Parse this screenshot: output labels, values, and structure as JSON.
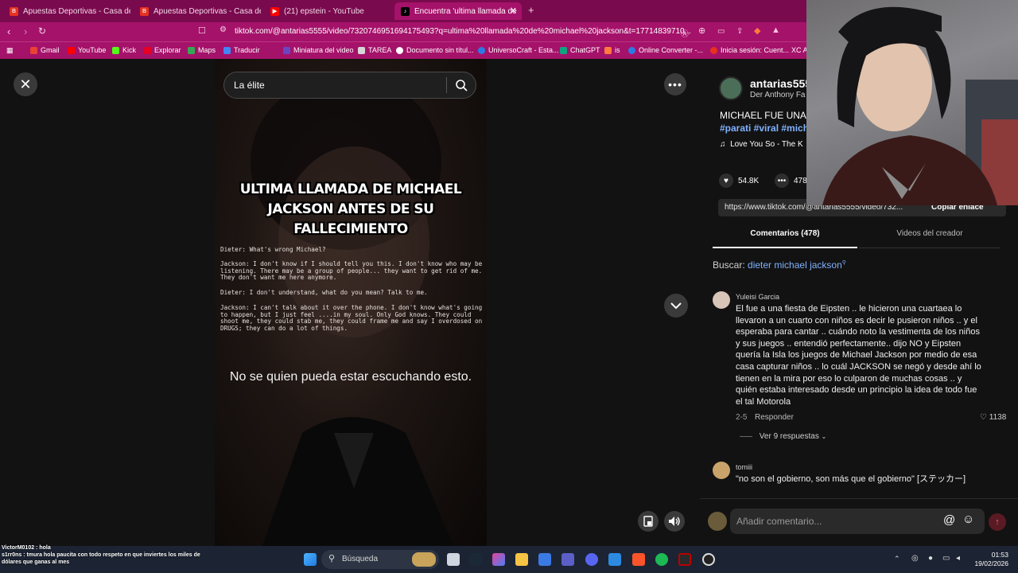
{
  "browser": {
    "tabs": [
      {
        "label": "Apuestas Deportivas - Casa de Apue",
        "icon": "casino-icon"
      },
      {
        "label": "Apuestas Deportivas - Casa de Apue",
        "icon": "casino-icon"
      },
      {
        "label": "(21) epstein - YouTube",
        "icon": "youtube-icon"
      },
      {
        "label": "Encuentra 'ultima llamada de",
        "icon": "tiktok-icon",
        "active": true
      }
    ],
    "url": "tiktok.com/@antarias5555/video/7320746951694175493?q=ultima%20llamada%20de%20michael%20jackson&t=17714839710...",
    "bookmarks": [
      "Gmail",
      "YouTube",
      "Kick",
      "Explorar",
      "Maps",
      "Traducir",
      "Miniatura del video",
      "TAREA",
      "Documento sin títul...",
      "UniversoCraft - Esta...",
      "ChatGPT",
      "is",
      "Online Converter -...",
      "Inicia sesión: Cuent...",
      "XC A"
    ]
  },
  "viewer": {
    "search_value": "La élite",
    "video_title": "ULTIMA LLAMADA DE MICHAEL JACKSON ANTES DE SU FALLECIMIENTO",
    "dialog": [
      "Dieter: What's wrong Michael?",
      "Jackson: I don't know if I should tell you this. I don't know who may be listening. There may be a group of people... they want to get rid of me. They don't want me here anymore.",
      "Dieter: I don't understand, what do you mean? Talk to me.",
      "Jackson: I can't talk about it over the phone. I don't know what's going to happen, but I just feel ....in my soul. Only God knows. They could shoot me, they could stab me, they could frame me and say I overdosed on DRUGS; they can do a lot of things."
    ],
    "subtitle": "No se quien pueda estar escuchando esto."
  },
  "post": {
    "author": "antarias5555",
    "author_sub": "Der Anthony Fa",
    "description": "MICHAEL FUE UNA V",
    "tags": "#parati #viral #mich",
    "music": "Love You So - The K",
    "likes": "54.8K",
    "comments_count": "478",
    "link": "https://www.tiktok.com/@antarias5555/video/732...",
    "copy_label": "Copiar enlace",
    "tab_comments": "Comentarios (478)",
    "tab_videos": "Videos del creador",
    "search_prefix": "Buscar:",
    "search_term": "dieter michael jackson"
  },
  "comments": [
    {
      "user": "Yuleisi Garcia",
      "text": "El fue a una fiesta de Eipsten .. le hicieron una cuartaea lo llevaron a un cuarto con niños es decir le pusieron niños .. y el esperaba para cantar .. cuándo noto la vestimenta de los niños y sus juegos .. entendió perfectamente.. dijo NO y Eipsten quería la Isla los juegos de Michael Jackson por medio de esa casa capturar niños .. lo cuál JACKSON se negó y desde ahí lo tienen en la mira por eso lo culparon de muchas cosas .. y quién estaba interesado desde un principio la idea de todo fue el tal Motorola",
      "date": "2-5",
      "reply": "Responder",
      "likes": "1138",
      "replies": "Ver 9 respuestas"
    },
    {
      "user": "tomiii",
      "text": "\"no son el gobierno, son más que el gobierno\" [ステッカー]"
    }
  ],
  "comment_input": {
    "placeholder": "Añadir comentario..."
  },
  "taskbar": {
    "search": "Búsqueda",
    "time": "01:53",
    "date": "19/02/2026"
  },
  "stream_chat": [
    "VictorM0102 : hola",
    "s1rr0ns : tmura hola paucita con todo respeto en que inviertes los miles de dólares que ganas al mes"
  ],
  "colors": {
    "browser_chrome": "#a5126a",
    "tab_strip": "#7a0a4e",
    "link_blue": "#7fb2ff",
    "bg": "#121212"
  }
}
